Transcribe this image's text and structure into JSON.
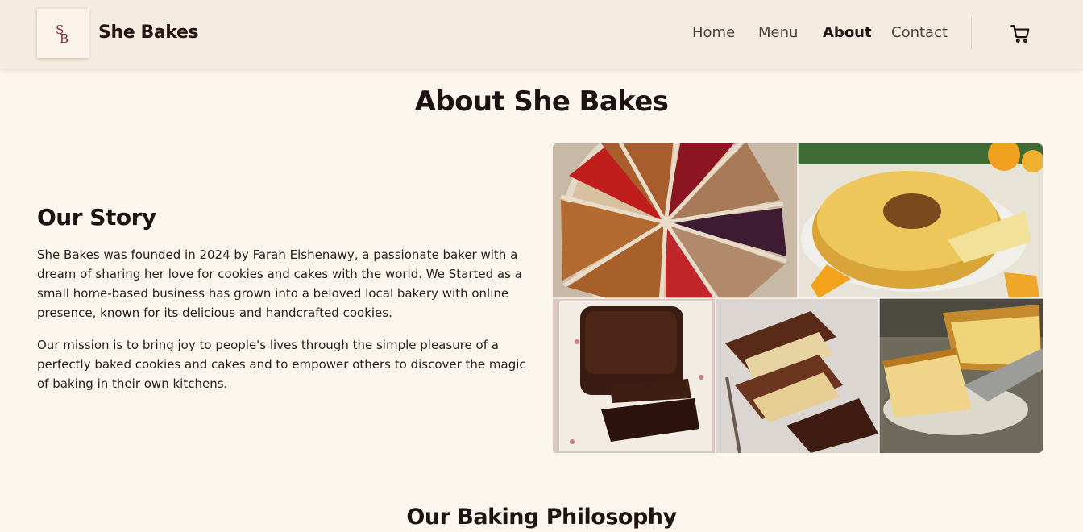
{
  "header": {
    "logo_text": "SB",
    "brand": "She Bakes",
    "nav": [
      {
        "label": "Home",
        "active": false
      },
      {
        "label": "Menu",
        "active": false
      },
      {
        "label": "About",
        "active": true
      },
      {
        "label": "Contact",
        "active": false
      }
    ],
    "cart_icon": "shopping-cart-icon"
  },
  "main": {
    "page_title": "About She Bakes",
    "story": {
      "heading": "Our Story",
      "paragraphs": [
        "She Bakes was founded in 2024 by Farah Elshenawy, a passionate baker with a dream of sharing her love for cookies and cakes with the world. We Started as a small home-based business has grown into a beloved local bakery with online presence, known for its delicious and handcrafted cookies.",
        "Our mission is to bring joy to people's lives through the simple pleasure of a perfectly baked cookies and cakes and to empower others to discover the magic of baking in their own kitchens."
      ]
    },
    "gallery": {
      "photos": [
        "jam-and-caramel-tart-slices",
        "orange-bundt-cake",
        "chocolate-loaf-cake",
        "marble-cake-slices",
        "orange-loaf-cake"
      ]
    },
    "philosophy_heading": "Our Baking Philosophy"
  },
  "colors": {
    "page_bg": "#fdf6ef",
    "header_bg": "#f6ebe0",
    "text": "#241414",
    "logo_accent": "#8a2a2e"
  }
}
